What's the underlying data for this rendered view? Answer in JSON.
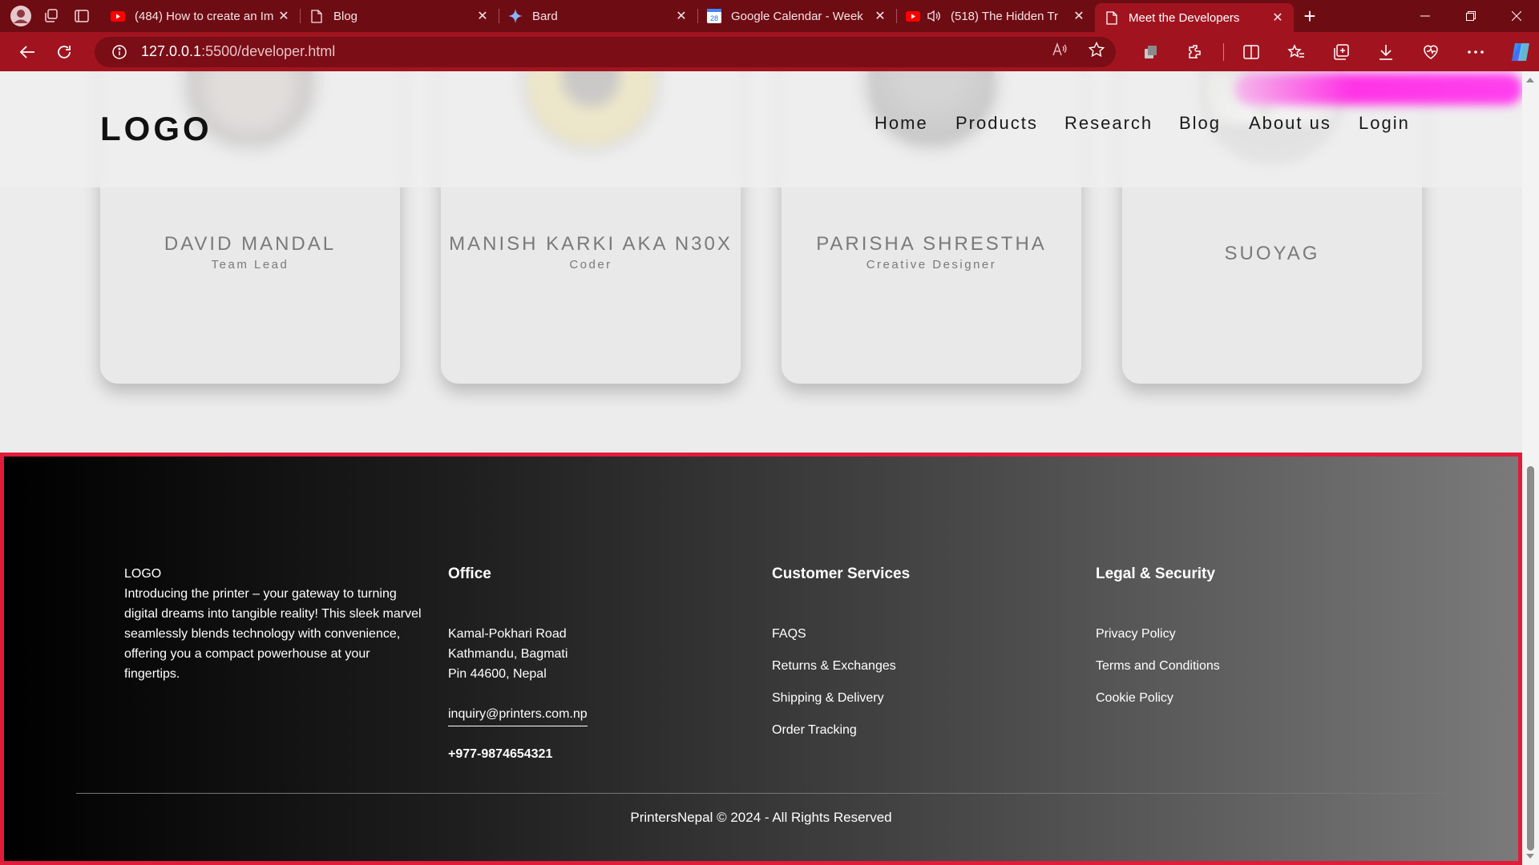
{
  "browser": {
    "tabs": [
      {
        "title": "(484) How to create an Im",
        "icon": "youtube-icon"
      },
      {
        "title": "Blog",
        "icon": "page-icon"
      },
      {
        "title": "Bard",
        "icon": "bard-icon"
      },
      {
        "title": "Google Calendar - Week",
        "icon": "calendar-icon"
      },
      {
        "title": "(518) The Hidden Tr",
        "icon": "youtube-icon"
      },
      {
        "title": "Meet the Developers",
        "icon": "page-icon"
      }
    ],
    "url_host": "127.0.0.1",
    "url_path": ":5500/developer.html",
    "calendar_day": "28",
    "colors": {
      "tabbar": "#6e0c14",
      "toolbar": "#a1141f"
    }
  },
  "header": {
    "logo": "LOGO",
    "nav": [
      "Home",
      "Products",
      "Research",
      "Blog",
      "About us",
      "Login"
    ]
  },
  "developers": [
    {
      "name": "DAVID MANDAL",
      "role": "Team Lead"
    },
    {
      "name": "MANISH KARKI AKA N30X",
      "role": "Coder"
    },
    {
      "name": "PARISHA SHRESTHA",
      "role": "Creative Designer"
    },
    {
      "name": "SUOYAG",
      "role": ""
    }
  ],
  "footer": {
    "logo": "LOGO",
    "description": "Introducing the printer – your gateway to turning digital dreams into tangible reality! This sleek marvel seamlessly blends technology with convenience, offering you a compact powerhouse at your fingertips.",
    "office": {
      "heading": "Office",
      "address": [
        "Kamal-Pokhari Road",
        "Kathmandu, Bagmati",
        "Pin 44600, Nepal"
      ],
      "email": "inquiry@printers.com.np",
      "phone": "+977-9874654321"
    },
    "customer_services": {
      "heading": "Customer Services",
      "links": [
        "FAQS",
        "Returns & Exchanges",
        "Shipping & Delivery",
        "Order Tracking"
      ]
    },
    "legal": {
      "heading": "Legal & Security",
      "links": [
        "Privacy Policy",
        "Terms and Conditions",
        "Cookie Policy"
      ]
    },
    "copyright": "PrintersNepal © 2024 - All Rights Reserved",
    "border_color": "#e21b3a"
  }
}
